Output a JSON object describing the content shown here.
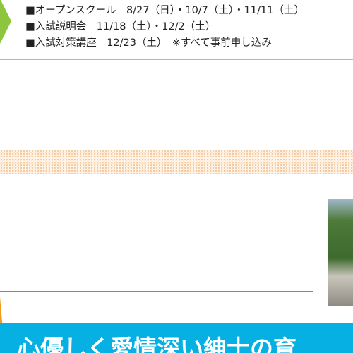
{
  "schedule": [
    "■オープンスクール　8/27（日）・10/7（土）・11/11（土）",
    "■入試説明会　11/18（土）・12/2（土）",
    "■入試対策講座　12/23（土）　※すべて事前申し込み"
  ],
  "banner": {
    "text": "心優しく愛情深い紳士の育"
  },
  "colors": {
    "accent_green": "#8cc63f",
    "banner_blue": "#06b0e3",
    "orange": "#f39a1e"
  }
}
